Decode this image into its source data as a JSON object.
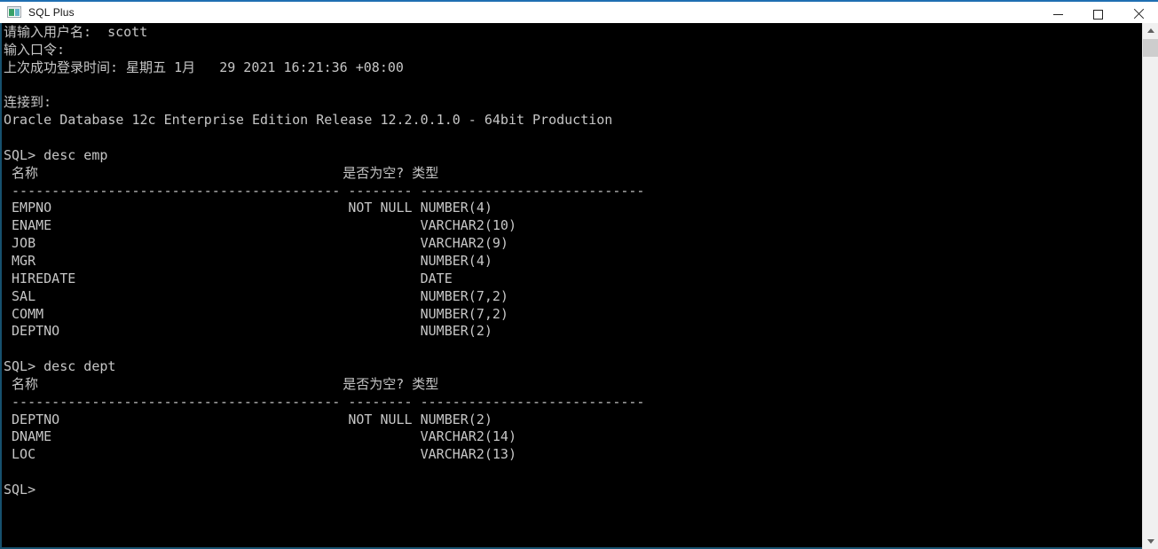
{
  "window": {
    "title": "SQL Plus",
    "icon": "console-window-icon",
    "controls": {
      "minimize": "Minimize",
      "maximize": "Maximize",
      "close": "Close"
    }
  },
  "theme": {
    "terminal_background": "#000000",
    "terminal_foreground": "#c6c6c6",
    "titlebar_background": "#ffffff",
    "accent_border": "#16516e",
    "titlebar_accent": "#1f6fb2"
  },
  "scrollbar": {
    "up_arrow": "scroll-up",
    "down_arrow": "scroll-down",
    "thumb": "scroll-thumb"
  },
  "terminal": {
    "lines": [
      "请输入用户名:  scott",
      "输入口令:",
      "上次成功登录时间: 星期五 1月   29 2021 16:21:36 +08:00",
      "",
      "连接到:",
      "Oracle Database 12c Enterprise Edition Release 12.2.0.1.0 - 64bit Production",
      "",
      "SQL> desc emp",
      " 名称                                      是否为空? 类型",
      " ----------------------------------------- -------- ----------------------------",
      " EMPNO                                     NOT NULL NUMBER(4)",
      " ENAME                                              VARCHAR2(10)",
      " JOB                                                VARCHAR2(9)",
      " MGR                                                NUMBER(4)",
      " HIREDATE                                           DATE",
      " SAL                                                NUMBER(7,2)",
      " COMM                                               NUMBER(7,2)",
      " DEPTNO                                             NUMBER(2)",
      "",
      "SQL> desc dept",
      " 名称                                      是否为空? 类型",
      " ----------------------------------------- -------- ----------------------------",
      " DEPTNO                                    NOT NULL NUMBER(2)",
      " DNAME                                              VARCHAR2(14)",
      " LOC                                                VARCHAR2(13)",
      "",
      "SQL>"
    ],
    "session": {
      "username_prompt": "请输入用户名:",
      "username_value": "scott",
      "password_prompt": "输入口令:",
      "last_login_label": "上次成功登录时间:",
      "last_login_value": "星期五 1月   29 2021 16:21:36 +08:00",
      "connected_label": "连接到:",
      "banner": "Oracle Database 12c Enterprise Edition Release 12.2.0.1.0 - 64bit Production",
      "prompt": "SQL>"
    },
    "commands": [
      "desc emp",
      "desc dept"
    ],
    "describe_results": [
      {
        "table": "emp",
        "command": "SQL> desc emp",
        "headers": [
          "名称",
          "是否为空?",
          "类型"
        ],
        "rows": [
          {
            "name": "EMPNO",
            "nullable": "NOT NULL",
            "type": "NUMBER(4)"
          },
          {
            "name": "ENAME",
            "nullable": "",
            "type": "VARCHAR2(10)"
          },
          {
            "name": "JOB",
            "nullable": "",
            "type": "VARCHAR2(9)"
          },
          {
            "name": "MGR",
            "nullable": "",
            "type": "NUMBER(4)"
          },
          {
            "name": "HIREDATE",
            "nullable": "",
            "type": "DATE"
          },
          {
            "name": "SAL",
            "nullable": "",
            "type": "NUMBER(7,2)"
          },
          {
            "name": "COMM",
            "nullable": "",
            "type": "NUMBER(7,2)"
          },
          {
            "name": "DEPTNO",
            "nullable": "",
            "type": "NUMBER(2)"
          }
        ]
      },
      {
        "table": "dept",
        "command": "SQL> desc dept",
        "headers": [
          "名称",
          "是否为空?",
          "类型"
        ],
        "rows": [
          {
            "name": "DEPTNO",
            "nullable": "NOT NULL",
            "type": "NUMBER(2)"
          },
          {
            "name": "DNAME",
            "nullable": "",
            "type": "VARCHAR2(14)"
          },
          {
            "name": "LOC",
            "nullable": "",
            "type": "VARCHAR2(13)"
          }
        ]
      }
    ]
  }
}
